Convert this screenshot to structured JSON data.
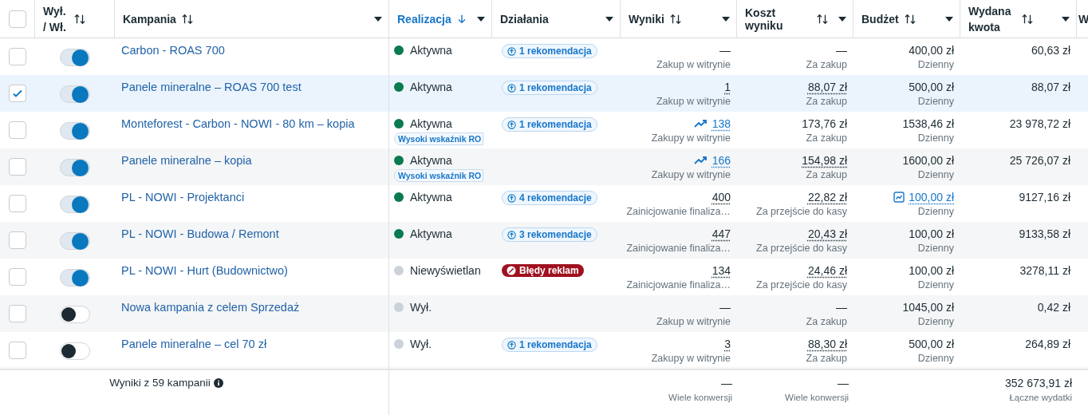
{
  "table": {
    "columns": [
      {
        "kind": "checkbox",
        "checked": false
      },
      {
        "kind": "sortable",
        "label": "Wył. / Wł.",
        "sorted": false,
        "menu": false
      },
      {
        "kind": "sortable",
        "label": "Kampania",
        "sorted": false,
        "menu": true
      },
      {
        "kind": "sortable",
        "label": "Realizacja",
        "sorted": true,
        "menu": true
      },
      {
        "kind": "plain",
        "label": "Działania",
        "sorted": false,
        "menu": true
      },
      {
        "kind": "sortable",
        "label": "Wyniki",
        "sorted": false,
        "menu": true
      },
      {
        "kind": "sortable",
        "label": "Koszt wyniku",
        "sorted": false,
        "menu": true
      },
      {
        "kind": "sortable",
        "label": "Budżet",
        "sorted": false,
        "menu": true
      },
      {
        "kind": "sortable",
        "label": "Wydana kwota",
        "sorted": false,
        "menu": true
      },
      {
        "kind": "plain",
        "label": "W",
        "sorted": false,
        "menu": false
      }
    ],
    "rows": [
      {
        "selected": false,
        "on": true,
        "name": "Carbon - ROAS 700",
        "status": "Aktywna",
        "color": "#0a7a50",
        "alert": null,
        "action": {
          "kind": "recommendation",
          "label": "1 rekomendacja"
        },
        "results": {
          "value": "—",
          "dotted": false,
          "trend": false,
          "sub": "Zakup w witrynie"
        },
        "cost": {
          "value": "—",
          "dotted": false,
          "sub": "Za zakup"
        },
        "budget": {
          "value": "400,00 zł",
          "chart": false,
          "sub": "Dzienny"
        },
        "spent": "60,63 zł"
      },
      {
        "selected": true,
        "on": true,
        "name": "Panele mineralne – ROAS 700 test",
        "status": "Aktywna",
        "color": "#0a7a50",
        "alert": null,
        "action": {
          "kind": "recommendation",
          "label": "1 rekomendacja"
        },
        "results": {
          "value": "1",
          "dotted": true,
          "trend": false,
          "sub": "Zakup w witrynie"
        },
        "cost": {
          "value": "88,07 zł",
          "dotted": true,
          "sub": "Za zakup"
        },
        "budget": {
          "value": "500,00 zł",
          "chart": false,
          "sub": "Dzienny"
        },
        "spent": "88,07 zł"
      },
      {
        "selected": false,
        "on": true,
        "name": "Monteforest - Carbon - NOWI - 80 km – kopia",
        "status": "Aktywna",
        "color": "#0a7a50",
        "alert": "Wysoki wskaźnik RO",
        "action": {
          "kind": "recommendation",
          "label": "1 rekomendacja"
        },
        "results": {
          "value": "138",
          "dotted": true,
          "trend": true,
          "sub": "Zakupy w witrynie"
        },
        "cost": {
          "value": "173,76 zł",
          "dotted": false,
          "sub": "Za zakup"
        },
        "budget": {
          "value": "1538,46 zł",
          "chart": false,
          "sub": "Dzienny"
        },
        "spent": "23 978,72 zł"
      },
      {
        "selected": false,
        "on": true,
        "name": "Panele mineralne – kopia",
        "status": "Aktywna",
        "color": "#0a7a50",
        "alert": "Wysoki wskaźnik RO",
        "action": null,
        "results": {
          "value": "166",
          "dotted": true,
          "trend": true,
          "sub": "Zakupy w witrynie"
        },
        "cost": {
          "value": "154,98 zł",
          "dotted": true,
          "sub": "Za zakup"
        },
        "budget": {
          "value": "1600,00 zł",
          "chart": false,
          "sub": "Dzienny"
        },
        "spent": "25 726,07 zł"
      },
      {
        "selected": false,
        "on": true,
        "name": "PL - NOWI - Projektanci",
        "status": "Aktywna",
        "color": "#0a7a50",
        "alert": null,
        "action": {
          "kind": "recommendation",
          "label": "4 rekomendacje"
        },
        "results": {
          "value": "400",
          "dotted": true,
          "trend": false,
          "sub": "Zainicjowanie finaliza…"
        },
        "cost": {
          "value": "22,82 zł",
          "dotted": true,
          "sub": "Za przejście do kasy"
        },
        "budget": {
          "value": "100,00 zł",
          "chart": true,
          "sub": "Dzienny"
        },
        "spent": "9127,16 zł"
      },
      {
        "selected": false,
        "on": true,
        "name": "PL - NOWI - Budowa / Remont",
        "status": "Aktywna",
        "color": "#0a7a50",
        "alert": null,
        "action": {
          "kind": "recommendation",
          "label": "3 rekomendacje"
        },
        "results": {
          "value": "447",
          "dotted": true,
          "trend": false,
          "sub": "Zainicjowanie finaliza…"
        },
        "cost": {
          "value": "20,43 zł",
          "dotted": true,
          "sub": "Za przejście do kasy"
        },
        "budget": {
          "value": "100,00 zł",
          "chart": false,
          "sub": "Dzienny"
        },
        "spent": "9133,58 zł"
      },
      {
        "selected": false,
        "on": true,
        "name": "PL - NOWI - Hurt (Budownictwo)",
        "status": "Niewyświetlan",
        "color": "#cbd2d9",
        "alert": null,
        "action": {
          "kind": "error",
          "label": "Błędy reklam"
        },
        "results": {
          "value": "134",
          "dotted": true,
          "trend": false,
          "sub": "Zainicjowanie finaliza…"
        },
        "cost": {
          "value": "24,46 zł",
          "dotted": true,
          "sub": "Za przejście do kasy"
        },
        "budget": {
          "value": "100,00 zł",
          "chart": false,
          "sub": "Dzienny"
        },
        "spent": "3278,11 zł"
      },
      {
        "selected": false,
        "on": false,
        "name": "Nowa kampania z celem Sprzedaż",
        "status": "Wył.",
        "color": "#cbd2d9",
        "alert": null,
        "action": null,
        "results": {
          "value": "—",
          "dotted": false,
          "trend": false,
          "sub": "Zakup w witrynie"
        },
        "cost": {
          "value": "—",
          "dotted": false,
          "sub": "Za zakup"
        },
        "budget": {
          "value": "1045,00 zł",
          "chart": false,
          "sub": "Dzienny"
        },
        "spent": "0,42 zł"
      },
      {
        "selected": false,
        "on": false,
        "name": "Panele mineralne – cel 70 zł",
        "status": "Wył.",
        "color": "#cbd2d9",
        "alert": null,
        "action": {
          "kind": "recommendation",
          "label": "1 rekomendacja"
        },
        "results": {
          "value": "3",
          "dotted": true,
          "trend": false,
          "sub": "Zakupy w witrynie"
        },
        "cost": {
          "value": "88,30 zł",
          "dotted": true,
          "sub": "Za zakup"
        },
        "budget": {
          "value": "500,00 zł",
          "chart": false,
          "sub": "Dzienny"
        },
        "spent": "264,89 zł"
      }
    ],
    "footer": {
      "label": "Wyniki z 59 kampanii",
      "results": {
        "value": "—",
        "sub": "Wiele konwersji"
      },
      "cost": {
        "value": "—",
        "sub": "Wiele konwersji"
      },
      "spent": {
        "value": "352 673,91 zł",
        "sub": "Łączne wydatki"
      }
    }
  }
}
